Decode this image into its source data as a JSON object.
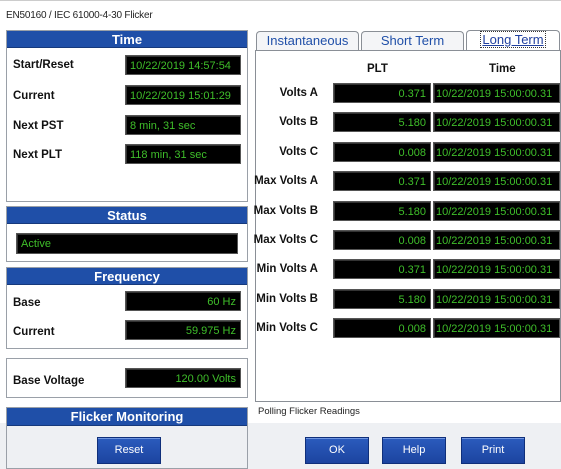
{
  "window": {
    "title": "EN50160 / IEC 61000-4-30 Flicker"
  },
  "time_panel": {
    "header": "Time",
    "rows": [
      {
        "label": "Start/Reset",
        "value": "10/22/2019 14:57:54"
      },
      {
        "label": "Current",
        "value": "10/22/2019 15:01:29"
      },
      {
        "label": "Next PST",
        "value": "8 min, 31 sec"
      },
      {
        "label": "Next PLT",
        "value": "118 min, 31 sec"
      }
    ]
  },
  "status_panel": {
    "header": "Status",
    "value": "Active"
  },
  "frequency_panel": {
    "header": "Frequency",
    "rows": [
      {
        "label": "Base",
        "value": "60 Hz"
      },
      {
        "label": "Current",
        "value": "59.975 Hz"
      }
    ]
  },
  "base_voltage": {
    "label": "Base Voltage",
    "value": "120.00 Volts"
  },
  "flicker_monitoring": {
    "header": "Flicker Monitoring",
    "reset_label": "Reset"
  },
  "tabs": [
    {
      "label": "Instantaneous",
      "active": false
    },
    {
      "label": "Short Term",
      "active": false
    },
    {
      "label": "Long Term",
      "active": true
    }
  ],
  "long_term": {
    "col_plt": "PLT",
    "col_time": "Time",
    "rows": [
      {
        "label": "Volts A",
        "plt": "0.371",
        "time": "10/22/2019 15:00:00.31"
      },
      {
        "label": "Volts B",
        "plt": "5.180",
        "time": "10/22/2019 15:00:00.31"
      },
      {
        "label": "Volts C",
        "plt": "0.008",
        "time": "10/22/2019 15:00:00.31"
      },
      {
        "label": "Max Volts A",
        "plt": "0.371",
        "time": "10/22/2019 15:00:00.31"
      },
      {
        "label": "Max Volts B",
        "plt": "5.180",
        "time": "10/22/2019 15:00:00.31"
      },
      {
        "label": "Max Volts C",
        "plt": "0.008",
        "time": "10/22/2019 15:00:00.31"
      },
      {
        "label": "Min Volts A",
        "plt": "0.371",
        "time": "10/22/2019 15:00:00.31"
      },
      {
        "label": "Min Volts B",
        "plt": "5.180",
        "time": "10/22/2019 15:00:00.31"
      },
      {
        "label": "Min Volts C",
        "plt": "0.008",
        "time": "10/22/2019 15:00:00.31"
      }
    ]
  },
  "status_bar": {
    "message": "Polling Flicker Readings"
  },
  "footer_buttons": {
    "ok": "OK",
    "help": "Help",
    "print": "Print"
  },
  "colors": {
    "header_blue": "#1f4fa8",
    "lcd_green": "#3fbf2a",
    "lcd_bg": "#000000"
  }
}
